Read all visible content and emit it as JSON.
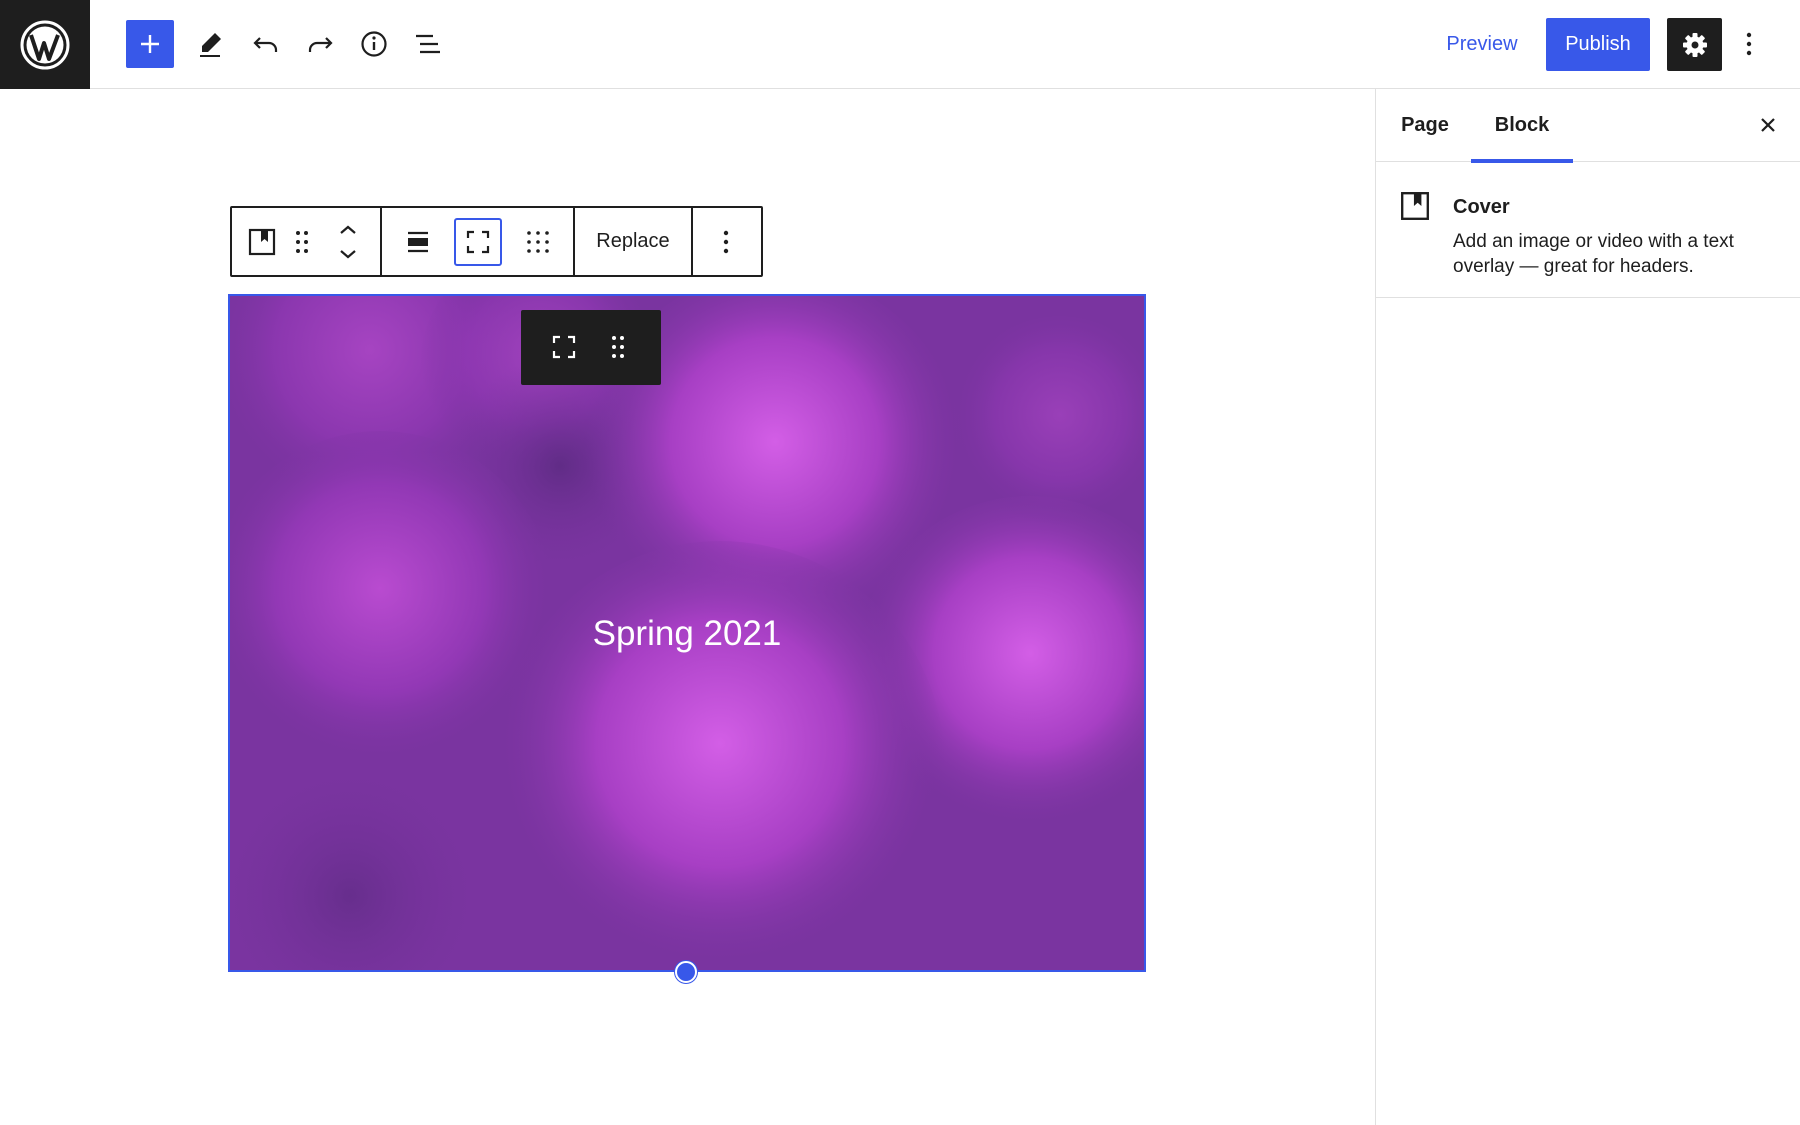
{
  "header": {
    "logo_icon": "wordpress-logo-icon",
    "toolbar_icons": [
      "plus-icon",
      "pencil-icon",
      "undo-icon",
      "redo-icon",
      "info-icon",
      "list-view-icon"
    ],
    "preview_label": "Preview",
    "publish_label": "Publish",
    "settings_icon": "gear-icon",
    "more_icon": "vertical-ellipsis-icon",
    "accent_color": "#3858e9"
  },
  "block_toolbar": {
    "icons": [
      "cover-block-icon",
      "drag-handle-icon",
      "move-up-down-icon",
      "align-icon",
      "fullscreen-icon",
      "content-position-icon"
    ],
    "replace_label": "Replace",
    "more_icon": "vertical-ellipsis-icon"
  },
  "cover": {
    "title": "Spring 2021",
    "overlay_color": "#7a34a0",
    "inner_toolbar_icons": [
      "fullscreen-icon",
      "drag-handle-icon"
    ]
  },
  "sidebar": {
    "tabs": [
      {
        "label": "Page",
        "active": false
      },
      {
        "label": "Block",
        "active": true
      }
    ],
    "close_icon": "close-icon",
    "block_card": {
      "icon": "cover-block-icon",
      "title": "Cover",
      "description": "Add an image or video with a text overlay — great for headers."
    }
  }
}
